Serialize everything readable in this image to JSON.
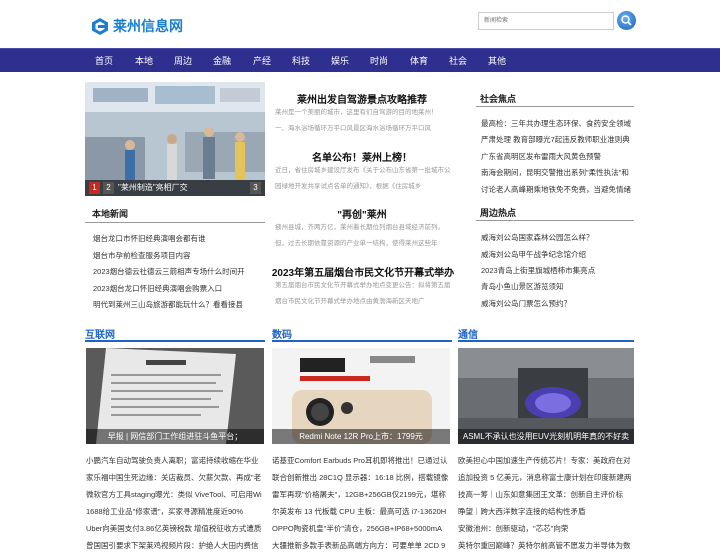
{
  "site": {
    "name": "莱州信息网",
    "brand_color": "#1a7fd0",
    "nav_color": "#2f2f8f",
    "accent_color": "#1f63c4"
  },
  "search": {
    "placeholder": "新闻检索"
  },
  "nav": [
    "首页",
    "本地",
    "周边",
    "金融",
    "产经",
    "科技",
    "娱乐",
    "时尚",
    "体育",
    "社会",
    "其他"
  ],
  "hero": {
    "caption": "\"莱州制造\"亮相厂交",
    "pages": [
      "1",
      "2",
      "3"
    ]
  },
  "local_news": {
    "title": "本地新闻",
    "items": [
      "烟台龙口市怀旧经典演唱会都有谁",
      "烟台市孕前检查服务项目内容",
      "2023烟台德云社德云三箭相声专场什么时间开",
      "2023烟台龙口怀旧经典演唱会购票入口",
      "明代到莱州三山岛旅游都能玩什么？看看接县"
    ]
  },
  "center": [
    {
      "headline": "莱州出发自驾游景点攻略推荐",
      "summary": [
        "莱州是一个美丽的城市，这里有们自驾游的目的地莱州！",
        "一、海水浴场循环万平口风景区海水浴场循环万平口风"
      ]
    },
    {
      "headline": "名单公布！莱州上榜！",
      "summary": [
        "近日，省住房城乡建设厅发布《关于公布山东省第一批城市公",
        "园绿地开发共享试点名单的通知》，根据《住房城乡"
      ]
    },
    {
      "headline": "\"再创\"莱州",
      "summary": [
        "掖州县城，齐两方亿，莱州着长期位列烟台县域经济前列。",
        "但，过去长期依靠资源的产业单一结构，使得莱州这些年"
      ]
    },
    {
      "headline": "2023年第五届烟台市民文化节开幕式举办",
      "summary": [
        "第五届烟台市民文化节开幕式举办地点变更公告：拟将第五届",
        "烟台市民文化节开幕式举办地点由黄渤海新区天地广"
      ]
    }
  ],
  "social": {
    "title": "社会焦点",
    "items": [
      "最高检：三年共办理生态环保、食药安全领域",
      "严肃处理 教育部曝光7起违反教师职业准则典",
      "广东省高明区发布雷雨大风黄色预警",
      "南海会期间，昆明交警推出系列\"柔性执法\"和",
      "讨论老人高峰期乘地铁免不免费，当避免情绪"
    ]
  },
  "nearby": {
    "title": "周边热点",
    "items": [
      "威海刘公岛国家森林公园怎么样？",
      "威海刘公岛甲午战争纪念馆介绍",
      "2023青岛上街里旗城栖柿市集亮点",
      "青岛小鱼山景区游览须知",
      "威海刘公岛门票怎么预约？"
    ]
  },
  "columns": [
    {
      "title": "互联网",
      "caption": "早报 | 网信部门工作组进驻斗鱼平台；",
      "lines": [
        "小鹏汽车自动驾驶负责人离职；富诺持续收缩在华业",
        "家乐福中国生死边缘：关店裁员、欠薪欠款、再成\"老",
        "微软官方工具staging曝光：类似 ViveTool、可启用Wi",
        "1688给工业品\"修家谱\"，买家寻源精准度近90%",
        "Uber向美国支付3.86亿英镑税款 增值税征收方式遭质",
        "曾国国引要求下架莱鸡视频片段：护绝人大田内费信"
      ]
    },
    {
      "title": "数码",
      "caption": "Redmi Note 12R Pro上市：1799元",
      "lines": [
        "诺基亚Comfort Earbuds Pro耳机即将推出！已通过认",
        "联合创新推出 28C1Q 显示器：16:18 比例，搭载镜像",
        "雷军再现\"价格屠夫\"，12GB+256GB仅2199元，堪称",
        "尔英发布 13 代板载 CPU 主板：最高可选 i7-13620H",
        "OPPO陶瓷机皇\"半价\"清仓，256GB+IP68+5000mA",
        "大疆推新多款手表新品高端方向方：可要单单 2CD 9"
      ]
    },
    {
      "title": "通信",
      "caption": "ASML不承认也没用EUV光刻机明年真的不好卖",
      "lines": [
        "欧美担心中国加速生产传统芯片！专家：美政府在对",
        "追加投资 5 亿美元，消息称富士康计划在印度新建两",
        "技高一筹｜山东如意集团王文革：创新自主评价标",
        "睁望｜跨大西洋数字连接的结构性矛盾",
        "安徽池州：创新驱动，\"芯芯\"向荣",
        "英特尔重回巅峰？英特尔前高管不愿发力半导体为数"
      ]
    }
  ]
}
